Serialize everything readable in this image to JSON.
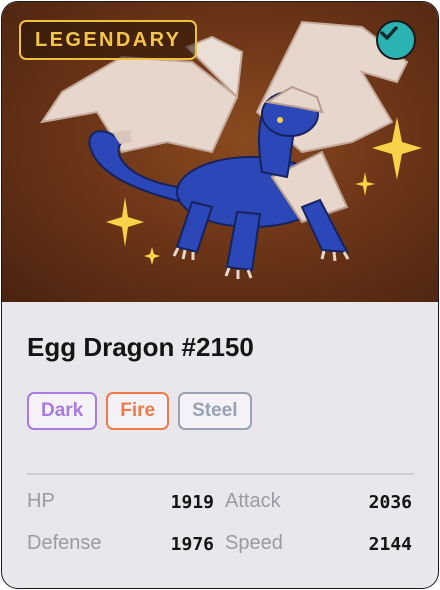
{
  "card": {
    "rarity": "LEGENDARY",
    "verified": true,
    "title": "Egg Dragon #2150",
    "types": [
      {
        "label": "Dark",
        "color": "#a77be0"
      },
      {
        "label": "Fire",
        "color": "#ee7a4a"
      },
      {
        "label": "Steel",
        "color": "#97a2b4"
      }
    ],
    "stats": [
      {
        "label": "HP",
        "value": "1919"
      },
      {
        "label": "Attack",
        "value": "2036"
      },
      {
        "label": "Defense",
        "value": "1976"
      },
      {
        "label": "Speed",
        "value": "2144"
      }
    ]
  },
  "colors": {
    "rarity": "#f0c040",
    "verified": "#2bb3b3",
    "art_background": "#6e3618",
    "dragon_body": "#2b47b8"
  },
  "icons": {
    "verified": "checkmark-icon",
    "artwork": "egg-dragon-illustration"
  }
}
